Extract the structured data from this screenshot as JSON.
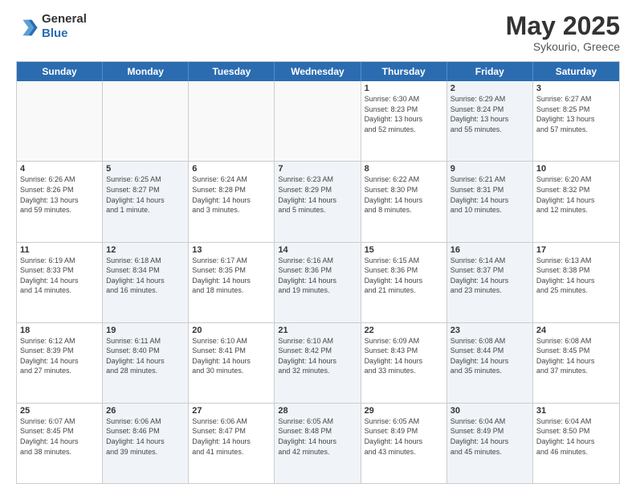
{
  "header": {
    "logo_line1": "General",
    "logo_line2": "Blue",
    "title": "May 2025",
    "subtitle": "Sykourio, Greece"
  },
  "calendar": {
    "days_of_week": [
      "Sunday",
      "Monday",
      "Tuesday",
      "Wednesday",
      "Thursday",
      "Friday",
      "Saturday"
    ],
    "rows": [
      [
        {
          "day": "",
          "info": "",
          "empty": true
        },
        {
          "day": "",
          "info": "",
          "empty": true
        },
        {
          "day": "",
          "info": "",
          "empty": true
        },
        {
          "day": "",
          "info": "",
          "empty": true
        },
        {
          "day": "1",
          "info": "Sunrise: 6:30 AM\nSunset: 8:23 PM\nDaylight: 13 hours\nand 52 minutes.",
          "shaded": false
        },
        {
          "day": "2",
          "info": "Sunrise: 6:29 AM\nSunset: 8:24 PM\nDaylight: 13 hours\nand 55 minutes.",
          "shaded": true
        },
        {
          "day": "3",
          "info": "Sunrise: 6:27 AM\nSunset: 8:25 PM\nDaylight: 13 hours\nand 57 minutes.",
          "shaded": false
        }
      ],
      [
        {
          "day": "4",
          "info": "Sunrise: 6:26 AM\nSunset: 8:26 PM\nDaylight: 13 hours\nand 59 minutes.",
          "shaded": false
        },
        {
          "day": "5",
          "info": "Sunrise: 6:25 AM\nSunset: 8:27 PM\nDaylight: 14 hours\nand 1 minute.",
          "shaded": true
        },
        {
          "day": "6",
          "info": "Sunrise: 6:24 AM\nSunset: 8:28 PM\nDaylight: 14 hours\nand 3 minutes.",
          "shaded": false
        },
        {
          "day": "7",
          "info": "Sunrise: 6:23 AM\nSunset: 8:29 PM\nDaylight: 14 hours\nand 5 minutes.",
          "shaded": true
        },
        {
          "day": "8",
          "info": "Sunrise: 6:22 AM\nSunset: 8:30 PM\nDaylight: 14 hours\nand 8 minutes.",
          "shaded": false
        },
        {
          "day": "9",
          "info": "Sunrise: 6:21 AM\nSunset: 8:31 PM\nDaylight: 14 hours\nand 10 minutes.",
          "shaded": true
        },
        {
          "day": "10",
          "info": "Sunrise: 6:20 AM\nSunset: 8:32 PM\nDaylight: 14 hours\nand 12 minutes.",
          "shaded": false
        }
      ],
      [
        {
          "day": "11",
          "info": "Sunrise: 6:19 AM\nSunset: 8:33 PM\nDaylight: 14 hours\nand 14 minutes.",
          "shaded": false
        },
        {
          "day": "12",
          "info": "Sunrise: 6:18 AM\nSunset: 8:34 PM\nDaylight: 14 hours\nand 16 minutes.",
          "shaded": true
        },
        {
          "day": "13",
          "info": "Sunrise: 6:17 AM\nSunset: 8:35 PM\nDaylight: 14 hours\nand 18 minutes.",
          "shaded": false
        },
        {
          "day": "14",
          "info": "Sunrise: 6:16 AM\nSunset: 8:36 PM\nDaylight: 14 hours\nand 19 minutes.",
          "shaded": true
        },
        {
          "day": "15",
          "info": "Sunrise: 6:15 AM\nSunset: 8:36 PM\nDaylight: 14 hours\nand 21 minutes.",
          "shaded": false
        },
        {
          "day": "16",
          "info": "Sunrise: 6:14 AM\nSunset: 8:37 PM\nDaylight: 14 hours\nand 23 minutes.",
          "shaded": true
        },
        {
          "day": "17",
          "info": "Sunrise: 6:13 AM\nSunset: 8:38 PM\nDaylight: 14 hours\nand 25 minutes.",
          "shaded": false
        }
      ],
      [
        {
          "day": "18",
          "info": "Sunrise: 6:12 AM\nSunset: 8:39 PM\nDaylight: 14 hours\nand 27 minutes.",
          "shaded": false
        },
        {
          "day": "19",
          "info": "Sunrise: 6:11 AM\nSunset: 8:40 PM\nDaylight: 14 hours\nand 28 minutes.",
          "shaded": true
        },
        {
          "day": "20",
          "info": "Sunrise: 6:10 AM\nSunset: 8:41 PM\nDaylight: 14 hours\nand 30 minutes.",
          "shaded": false
        },
        {
          "day": "21",
          "info": "Sunrise: 6:10 AM\nSunset: 8:42 PM\nDaylight: 14 hours\nand 32 minutes.",
          "shaded": true
        },
        {
          "day": "22",
          "info": "Sunrise: 6:09 AM\nSunset: 8:43 PM\nDaylight: 14 hours\nand 33 minutes.",
          "shaded": false
        },
        {
          "day": "23",
          "info": "Sunrise: 6:08 AM\nSunset: 8:44 PM\nDaylight: 14 hours\nand 35 minutes.",
          "shaded": true
        },
        {
          "day": "24",
          "info": "Sunrise: 6:08 AM\nSunset: 8:45 PM\nDaylight: 14 hours\nand 37 minutes.",
          "shaded": false
        }
      ],
      [
        {
          "day": "25",
          "info": "Sunrise: 6:07 AM\nSunset: 8:45 PM\nDaylight: 14 hours\nand 38 minutes.",
          "shaded": false
        },
        {
          "day": "26",
          "info": "Sunrise: 6:06 AM\nSunset: 8:46 PM\nDaylight: 14 hours\nand 39 minutes.",
          "shaded": true
        },
        {
          "day": "27",
          "info": "Sunrise: 6:06 AM\nSunset: 8:47 PM\nDaylight: 14 hours\nand 41 minutes.",
          "shaded": false
        },
        {
          "day": "28",
          "info": "Sunrise: 6:05 AM\nSunset: 8:48 PM\nDaylight: 14 hours\nand 42 minutes.",
          "shaded": true
        },
        {
          "day": "29",
          "info": "Sunrise: 6:05 AM\nSunset: 8:49 PM\nDaylight: 14 hours\nand 43 minutes.",
          "shaded": false
        },
        {
          "day": "30",
          "info": "Sunrise: 6:04 AM\nSunset: 8:49 PM\nDaylight: 14 hours\nand 45 minutes.",
          "shaded": true
        },
        {
          "day": "31",
          "info": "Sunrise: 6:04 AM\nSunset: 8:50 PM\nDaylight: 14 hours\nand 46 minutes.",
          "shaded": false
        }
      ]
    ]
  }
}
